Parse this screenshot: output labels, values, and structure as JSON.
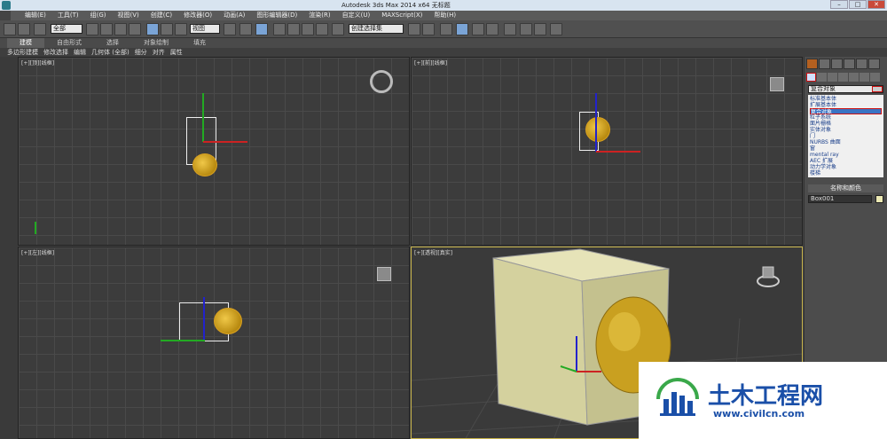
{
  "window": {
    "title": "Autodesk 3ds Max  2014 x64     无标题"
  },
  "menubar": {
    "items": [
      "编辑(E)",
      "工具(T)",
      "组(G)",
      "视图(V)",
      "创建(C)",
      "修改器(O)",
      "动画(A)",
      "图形编辑器(D)",
      "渲染(R)",
      "自定义(U)",
      "MAXScript(X)",
      "帮助(H)"
    ]
  },
  "toolbar": {
    "selection_filter": "全部",
    "ref_coord": "视图",
    "named_selection": "创建选择集"
  },
  "ribbon_tabs": [
    "建模",
    "自由形式",
    "选择",
    "对象绘制",
    "填充"
  ],
  "sub_tabs": [
    "多边形建模",
    "修改选择",
    "编辑",
    "几何体 (全部)",
    "细分",
    "对齐",
    "属性"
  ],
  "viewports": {
    "top": "[+][顶][线框]",
    "front": "[+][前][线框]",
    "left": "[+][左][线框]",
    "perspective": "[+][透视][真实]"
  },
  "command_panel": {
    "dropdown_value": "复合对象",
    "list": [
      "标准基本体",
      "扩展基本体",
      "复合对象",
      "粒子系统",
      "面片栅格",
      "实体对象",
      "门",
      "NURBS 曲面",
      "窗",
      "mental ray",
      "AEC 扩展",
      "动力学对象",
      "楼梯"
    ],
    "selected_index": 2,
    "rollout_title": "名称和颜色",
    "object_name": "Box001",
    "object_color": "#ece9b4"
  },
  "watermark": {
    "brand": "土木工程网",
    "url": "www.civilcn.com"
  }
}
